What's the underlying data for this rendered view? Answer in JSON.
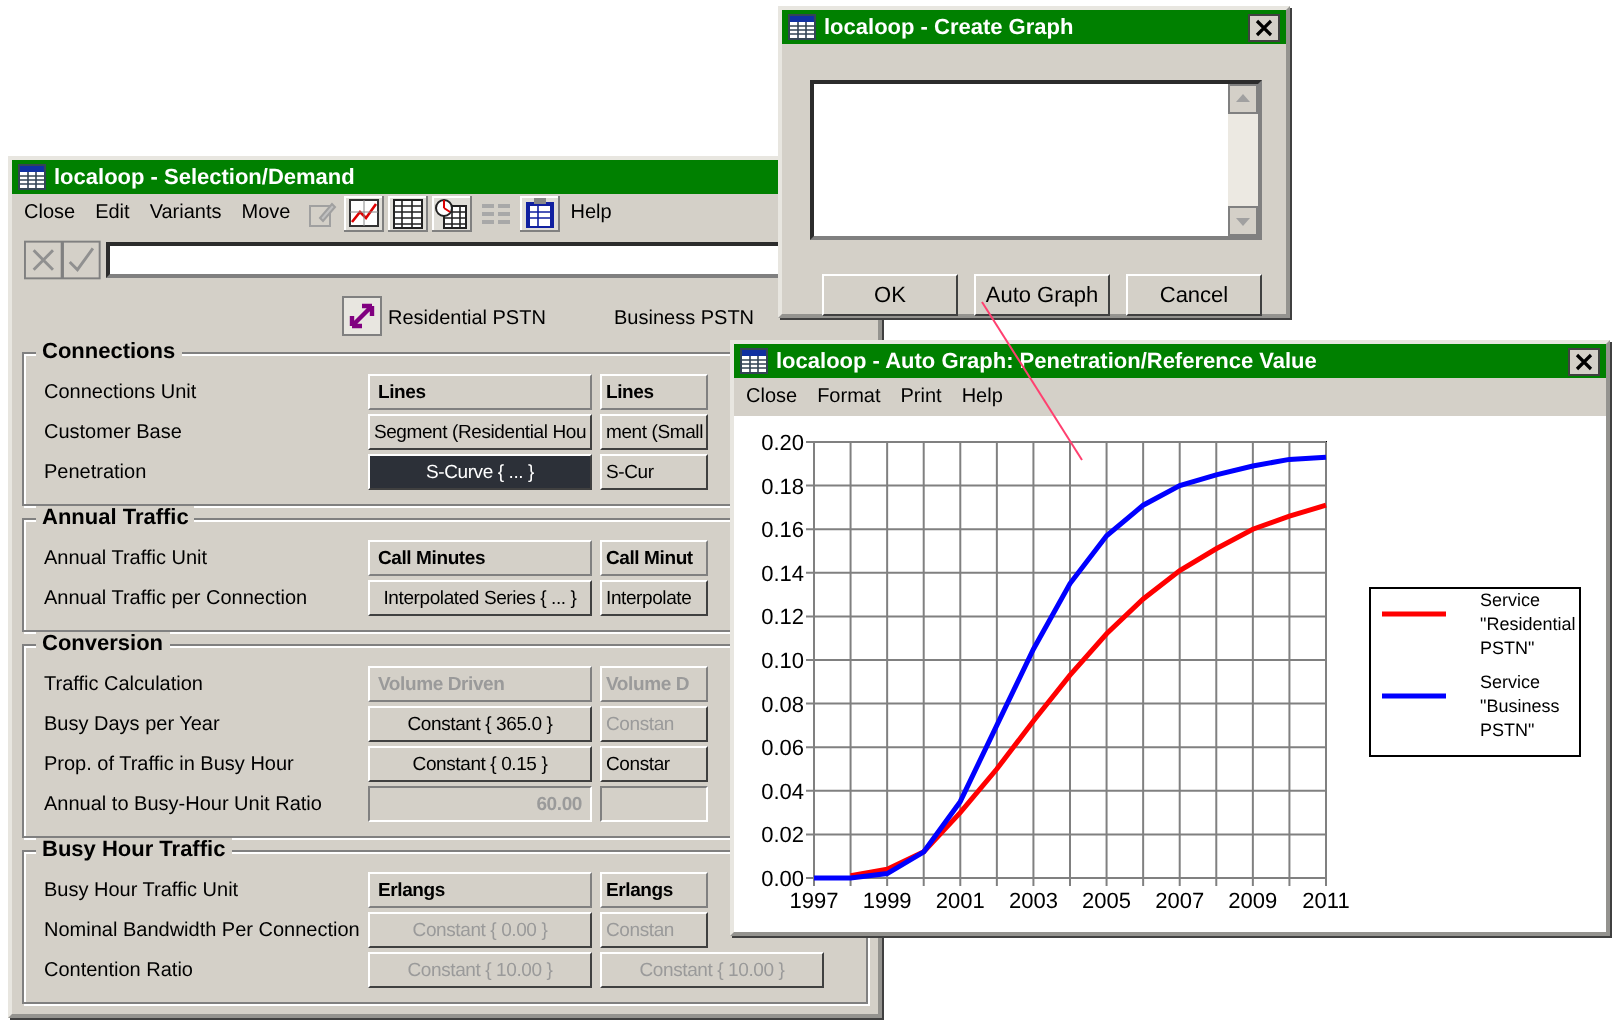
{
  "selection_window": {
    "title": "localoop - Selection/Demand",
    "menu": [
      "Close",
      "Edit",
      "Variants",
      "Move"
    ],
    "help_menu": "Help",
    "columns": [
      "Residential PSTN",
      "Business PSTN"
    ],
    "sections": [
      {
        "title": "Connections",
        "rows": [
          {
            "label": "Connections Unit",
            "cells": [
              {
                "text": "Lines",
                "kind": "unit",
                "disabled": false,
                "selected": false
              },
              {
                "text": "Lines",
                "kind": "unit",
                "disabled": false,
                "selected": false
              }
            ]
          },
          {
            "label": "Customer Base",
            "cells": [
              {
                "text": "Segment (Residential Hou",
                "kind": "button",
                "disabled": false,
                "selected": false
              },
              {
                "text": "ment (Small",
                "kind": "button",
                "disabled": false,
                "selected": false
              }
            ]
          },
          {
            "label": "Penetration",
            "cells": [
              {
                "text": "S-Curve { ... }",
                "kind": "button",
                "disabled": false,
                "selected": true
              },
              {
                "text": "S-Cur",
                "kind": "button",
                "disabled": false,
                "selected": false
              }
            ]
          }
        ]
      },
      {
        "title": "Annual Traffic",
        "rows": [
          {
            "label": "Annual Traffic Unit",
            "cells": [
              {
                "text": "Call Minutes",
                "kind": "unit",
                "disabled": false,
                "selected": false
              },
              {
                "text": "Call Minut",
                "kind": "unit",
                "disabled": false,
                "selected": false
              }
            ]
          },
          {
            "label": "Annual Traffic per Connection",
            "cells": [
              {
                "text": "Interpolated Series { ... }",
                "kind": "button",
                "disabled": false,
                "selected": false
              },
              {
                "text": "Interpolate",
                "kind": "button",
                "disabled": false,
                "selected": false
              }
            ]
          }
        ]
      },
      {
        "title": "Conversion",
        "rows": [
          {
            "label": "Traffic Calculation",
            "cells": [
              {
                "text": "Volume Driven",
                "kind": "unit",
                "disabled": true,
                "selected": false
              },
              {
                "text": "Volume D",
                "kind": "unit",
                "disabled": true,
                "selected": false
              }
            ]
          },
          {
            "label": "Busy Days per Year",
            "cells": [
              {
                "text": "Constant { 365.0 }",
                "kind": "button",
                "disabled": false,
                "selected": false
              },
              {
                "text": "Constan",
                "kind": "button",
                "disabled": true,
                "selected": false
              }
            ]
          },
          {
            "label": "Prop. of Traffic in Busy Hour",
            "cells": [
              {
                "text": "Constant { 0.15 }",
                "kind": "button",
                "disabled": false,
                "selected": false
              },
              {
                "text": "Constar",
                "kind": "button",
                "disabled": false,
                "selected": false
              }
            ]
          },
          {
            "label": "Annual to Busy-Hour Unit Ratio",
            "cells": [
              {
                "text": "60.00",
                "kind": "field",
                "disabled": true,
                "selected": false
              },
              {
                "kind": "field",
                "disabled": true,
                "selected": false
              }
            ]
          }
        ]
      },
      {
        "title": "Busy Hour Traffic",
        "rows": [
          {
            "label": "Busy Hour Traffic Unit",
            "cells": [
              {
                "text": "Erlangs",
                "kind": "unit",
                "disabled": false,
                "selected": false
              },
              {
                "text": "Erlangs",
                "kind": "unit",
                "disabled": false,
                "selected": false
              }
            ]
          },
          {
            "label": "Nominal Bandwidth Per Connection",
            "cells": [
              {
                "text": "Constant { 0.00 }",
                "kind": "button",
                "disabled": true,
                "selected": false
              },
              {
                "text": "Constan",
                "kind": "button",
                "disabled": true,
                "selected": false
              }
            ]
          },
          {
            "label": "Contention Ratio",
            "cells": [
              {
                "text": "Constant { 10.00 }",
                "kind": "button",
                "disabled": true,
                "selected": false
              },
              {
                "text": "Constant { 10.00 }",
                "kind": "button",
                "disabled": true,
                "selected": false
              }
            ]
          }
        ]
      }
    ]
  },
  "create_graph_dialog": {
    "title": "localoop - Create Graph",
    "buttons": [
      "OK",
      "Auto Graph",
      "Cancel"
    ]
  },
  "auto_graph_window": {
    "title": "localoop - Auto Graph: Penetration/Reference Value",
    "menu": [
      "Close",
      "Format",
      "Print",
      "Help"
    ],
    "chart_data": {
      "type": "line",
      "grid": true,
      "legend": true,
      "x": [
        1997,
        1998,
        1999,
        2000,
        2001,
        2002,
        2003,
        2004,
        2005,
        2006,
        2007,
        2008,
        2009,
        2010,
        2011
      ],
      "xlim": [
        1997,
        2011
      ],
      "ylim": [
        0,
        0.2
      ],
      "xticks": [
        1997,
        1999,
        2001,
        2003,
        2005,
        2007,
        2009,
        2011
      ],
      "yticks": [
        {
          "value": 0,
          "label": "0.00"
        },
        {
          "value": 0.02,
          "label": "0.02"
        },
        {
          "value": 0.04,
          "label": "0.04"
        },
        {
          "value": 0.06,
          "label": "0.06"
        },
        {
          "value": 0.08,
          "label": "0.08"
        },
        {
          "value": 0.1,
          "label": "0.10"
        },
        {
          "value": 0.12,
          "label": "0.12"
        },
        {
          "value": 0.14,
          "label": "0.14"
        },
        {
          "value": 0.16,
          "label": "0.16"
        },
        {
          "value": 0.18,
          "label": "0.18"
        },
        {
          "value": 0.2,
          "label": "0.20"
        }
      ],
      "series": [
        {
          "name": "Service \"Residential PSTN\"",
          "color": "#ff0000",
          "values": [
            null,
            0.001,
            0.004,
            0.012,
            0.03,
            0.05,
            0.072,
            0.093,
            0.112,
            0.128,
            0.141,
            0.151,
            0.16,
            0.166,
            0.171
          ]
        },
        {
          "name": "Service \"Business PSTN\"",
          "color": "#0000ff",
          "values": [
            0,
            0,
            0.002,
            0.012,
            0.035,
            0.07,
            0.105,
            0.135,
            0.157,
            0.171,
            0.18,
            0.185,
            0.189,
            0.192,
            0.193
          ]
        }
      ]
    }
  }
}
